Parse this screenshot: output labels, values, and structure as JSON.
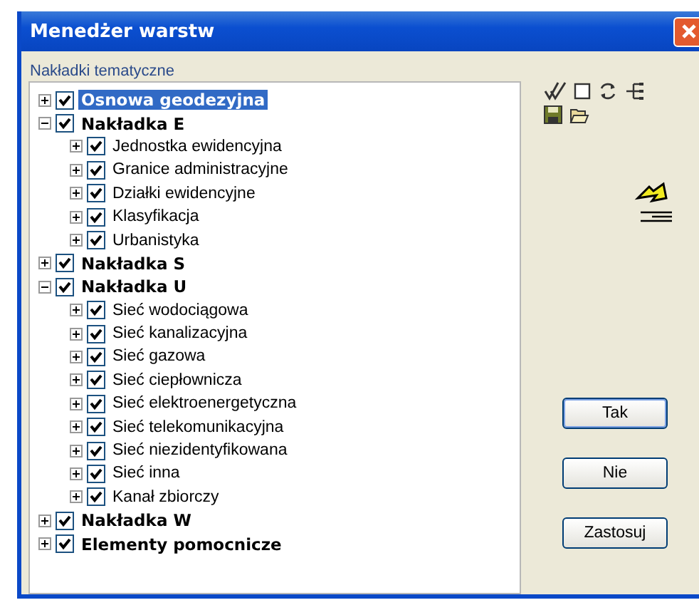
{
  "window": {
    "title": "Menedżer warstw"
  },
  "group": {
    "title": "Nakładki tematyczne"
  },
  "tree": [
    {
      "label": "Osnowa geodezyjna",
      "checked": true,
      "expanded": false,
      "selected": true
    },
    {
      "label": "Nakładka E",
      "checked": true,
      "expanded": true,
      "selected": false,
      "children": [
        {
          "label": "Jednostka ewidencyjna",
          "checked": true,
          "expanded": false,
          "selected": false
        },
        {
          "label": "Granice administracyjne",
          "checked": true,
          "expanded": false,
          "selected": false
        },
        {
          "label": "Działki ewidencyjne",
          "checked": true,
          "expanded": false,
          "selected": false
        },
        {
          "label": "Klasyfikacja",
          "checked": true,
          "expanded": false,
          "selected": false
        },
        {
          "label": "Urbanistyka",
          "checked": true,
          "expanded": false,
          "selected": false
        }
      ]
    },
    {
      "label": "Nakładka S",
      "checked": true,
      "expanded": false,
      "selected": false
    },
    {
      "label": "Nakładka U",
      "checked": true,
      "expanded": true,
      "selected": false,
      "children": [
        {
          "label": "Sieć wodociągowa",
          "checked": true,
          "expanded": false,
          "selected": false
        },
        {
          "label": "Sieć kanalizacyjna",
          "checked": true,
          "expanded": false,
          "selected": false
        },
        {
          "label": "Sieć gazowa",
          "checked": true,
          "expanded": false,
          "selected": false
        },
        {
          "label": "Sieć ciepłownicza",
          "checked": true,
          "expanded": false,
          "selected": false
        },
        {
          "label": "Sieć elektroenergetyczna",
          "checked": true,
          "expanded": false,
          "selected": false
        },
        {
          "label": "Sieć telekomunikacyjna",
          "checked": true,
          "expanded": false,
          "selected": false
        },
        {
          "label": "Sieć niezidentyfikowana",
          "checked": true,
          "expanded": false,
          "selected": false
        },
        {
          "label": "Sieć inna",
          "checked": true,
          "expanded": false,
          "selected": false
        },
        {
          "label": "Kanał zbiorczy",
          "checked": true,
          "expanded": false,
          "selected": false
        }
      ]
    },
    {
      "label": "Nakładka W",
      "checked": true,
      "expanded": false,
      "selected": false
    },
    {
      "label": "Elementy pomocnicze",
      "checked": true,
      "expanded": false,
      "selected": false
    }
  ],
  "buttons": [
    "Tak",
    "Nie",
    "Zastosuj"
  ]
}
